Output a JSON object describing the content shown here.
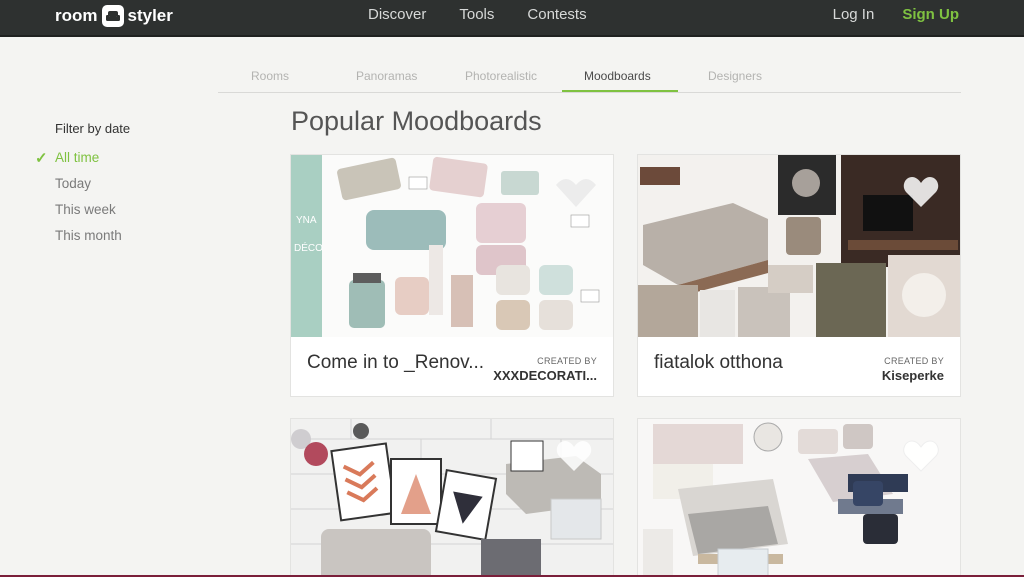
{
  "header": {
    "logo_left": "room",
    "logo_right": "styler",
    "nav": [
      "Discover",
      "Tools",
      "Contests"
    ],
    "login": "Log In",
    "signup": "Sign Up"
  },
  "tabs": [
    "Rooms",
    "Panoramas",
    "Photorealistic",
    "Moodboards",
    "Designers"
  ],
  "active_tab": "Moodboards",
  "sidebar": {
    "title": "Filter by date",
    "items": [
      "All time",
      "Today",
      "This week",
      "This month"
    ],
    "selected": "All time"
  },
  "main": {
    "title": "Popular Moodboards",
    "cards": [
      {
        "title": "Come in to _Renov...",
        "created_by_label": "CREATED BY",
        "creator": "XXXDECORATI..."
      },
      {
        "title": "fiatalok otthona",
        "created_by_label": "CREATED BY",
        "creator": "Kiseperke"
      },
      {
        "title": "",
        "created_by_label": "",
        "creator": ""
      },
      {
        "title": "",
        "created_by_label": "",
        "creator": ""
      }
    ]
  },
  "card1_image_text": {
    "side_line1": "YNA",
    "side_line2": "DÉCO"
  },
  "colors": {
    "accent": "#7fc241",
    "topbar": "#2e3130",
    "background": "#f4f4f2"
  }
}
